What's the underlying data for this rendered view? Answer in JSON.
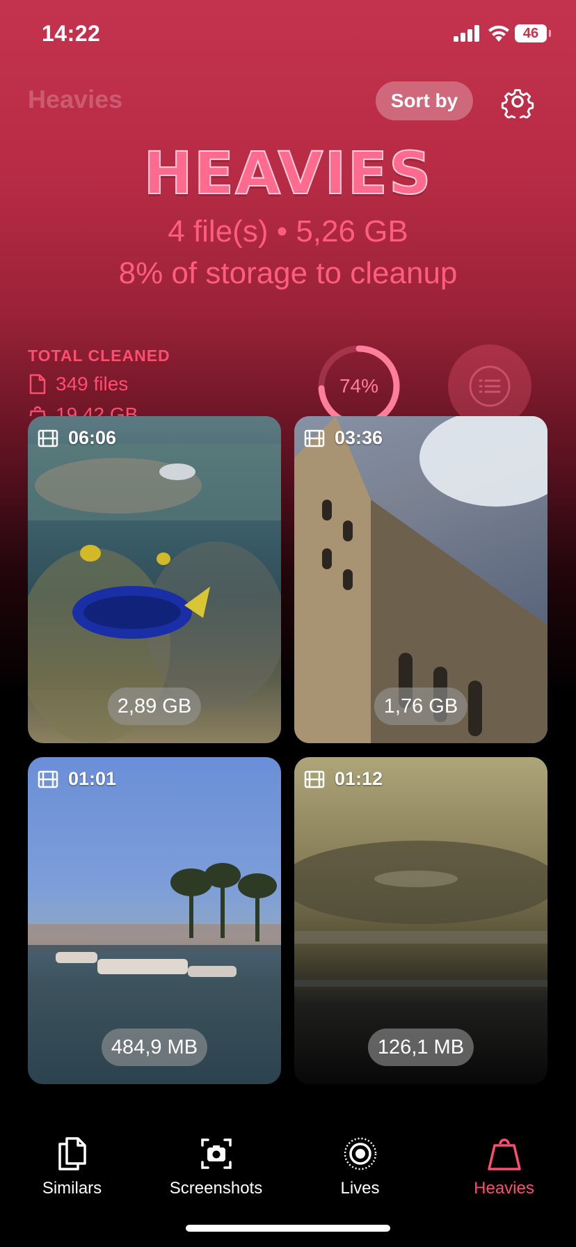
{
  "status_bar": {
    "time": "14:22",
    "battery": "46"
  },
  "header": {
    "title": "Heavies",
    "sort_label": "Sort by",
    "settings_icon": "gear-icon"
  },
  "hero": {
    "big_title": "HEAVIES",
    "summary": "4 file(s) • 5,26 GB",
    "storage_note": "8% of storage to cleanup"
  },
  "stats": {
    "label": "TOTAL CLEANED",
    "files": "349 files",
    "size": "19,42 GB",
    "progress_text": "74%",
    "progress_value": 0.74,
    "accent": "#ff4d6f"
  },
  "items": [
    {
      "duration": "06:06",
      "size": "2,89 GB",
      "icon": "film-icon"
    },
    {
      "duration": "03:36",
      "size": "1,76 GB",
      "icon": "film-icon"
    },
    {
      "duration": "01:01",
      "size": "484,9 MB",
      "icon": "film-icon"
    },
    {
      "duration": "01:12",
      "size": "126,1 MB",
      "icon": "film-icon"
    }
  ],
  "tabs": [
    {
      "label": "Similars",
      "icon": "copy-icon",
      "active": false
    },
    {
      "label": "Screenshots",
      "icon": "camera-frame-icon",
      "active": false
    },
    {
      "label": "Lives",
      "icon": "live-photo-icon",
      "active": false
    },
    {
      "label": "Heavies",
      "icon": "weight-icon",
      "active": true
    }
  ]
}
